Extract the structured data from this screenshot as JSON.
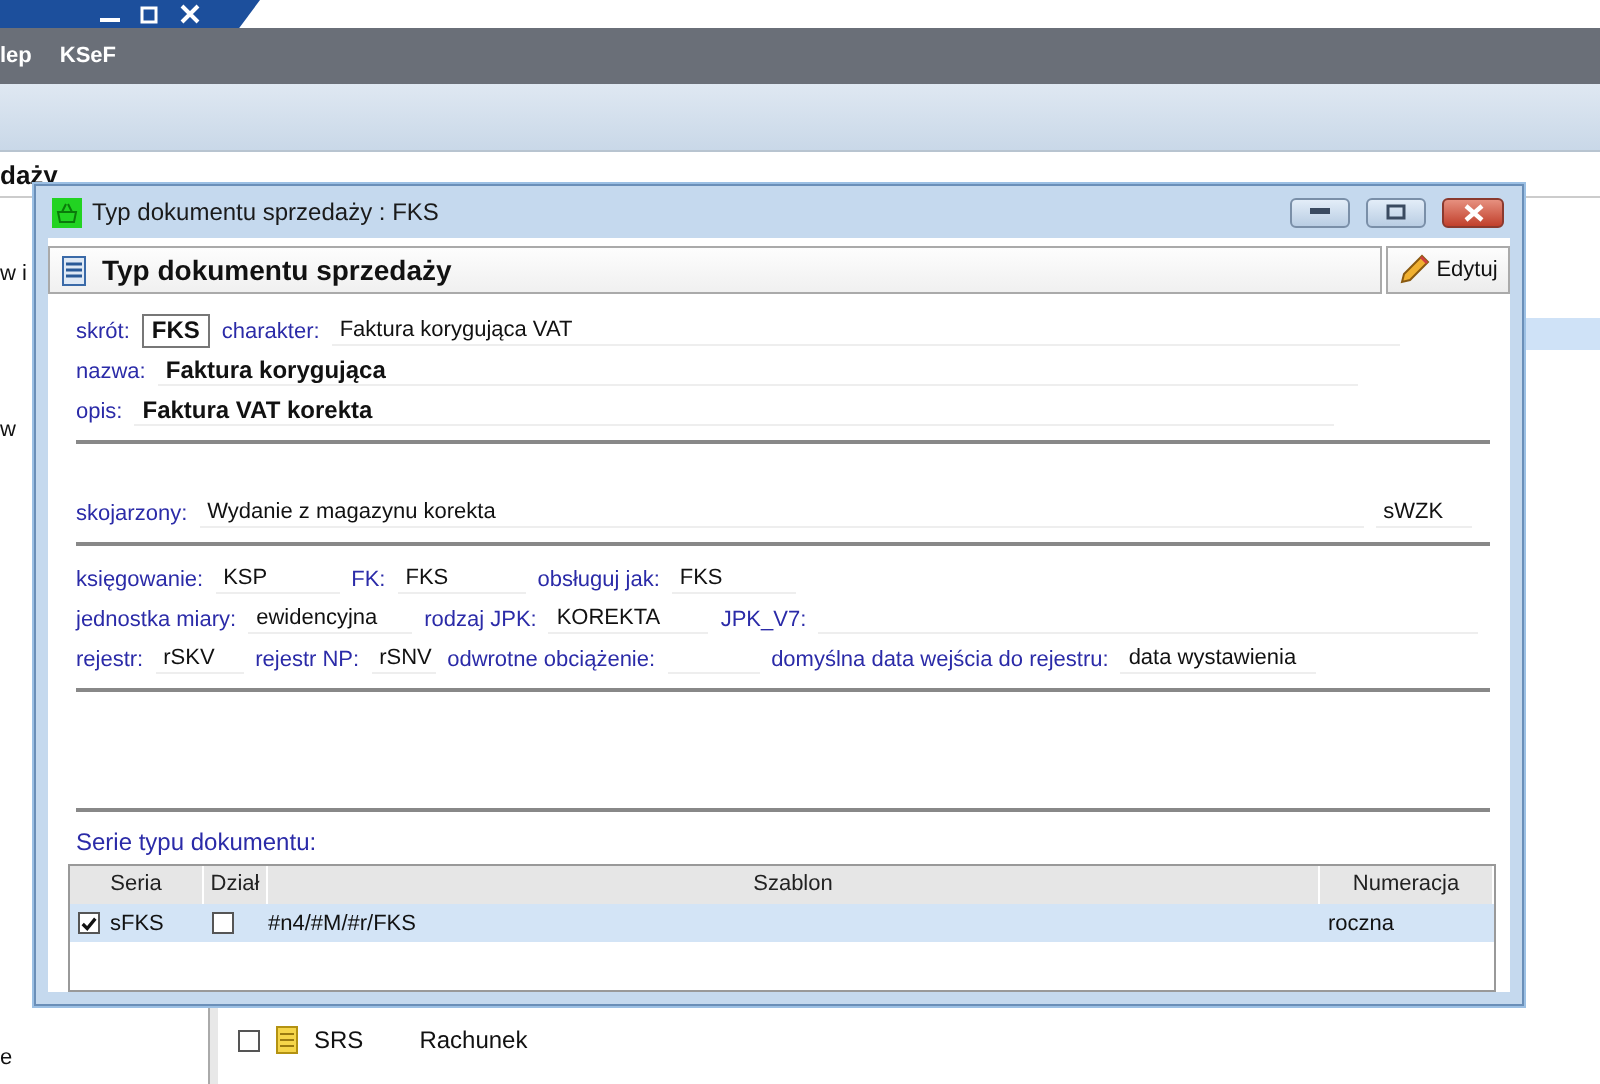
{
  "app": {
    "menu": [
      "lep",
      "KSeF"
    ],
    "heading": "daży",
    "left_pane": [
      "w i",
      "w",
      "e"
    ],
    "list_rows": [
      {
        "checked": false,
        "code": "SRS",
        "name": "Rachunek"
      }
    ]
  },
  "dialog": {
    "title": "Typ dokumentu sprzedaży : FKS",
    "header": "Typ dokumentu sprzedaży",
    "edit_button": "Edytuj",
    "sections": [
      [
        [
          {
            "label": "skrót:",
            "value": "FKS",
            "kind": "boxed"
          },
          {
            "label": "charakter:",
            "value": "Faktura korygująca VAT",
            "kind": "text"
          }
        ],
        [
          {
            "label": "nazwa:",
            "value": "Faktura korygująca",
            "kind": "bold"
          }
        ],
        [
          {
            "label": "opis:",
            "value": "Faktura VAT korekta",
            "kind": "bold"
          }
        ]
      ],
      [
        [
          {
            "label": "skojarzony:",
            "value": "Wydanie z magazynu korekta",
            "kind": "text"
          },
          {
            "value": "sWZK",
            "kind": "text"
          }
        ]
      ],
      [
        [
          {
            "label": "księgowanie:",
            "value": "KSP",
            "kind": "text"
          },
          {
            "label": "FK:",
            "value": "FKS",
            "kind": "text"
          },
          {
            "label": "obsługuj jak:",
            "value": "FKS",
            "kind": "text"
          }
        ],
        [
          {
            "label": "jednostka miary:",
            "value": "ewidencyjna",
            "kind": "text"
          },
          {
            "label": "rodzaj JPK:",
            "value": "KOREKTA",
            "kind": "text"
          },
          {
            "label": "JPK_V7:",
            "kind": "text"
          }
        ],
        [
          {
            "label": "rejestr:",
            "value": "rSKV",
            "kind": "text"
          },
          {
            "label": "rejestr NP:",
            "value": "rSNV",
            "kind": "text"
          },
          {
            "label": "odwrotne obciążenie:",
            "kind": "text"
          },
          {
            "label": "domyślna data wejścia do rejestru:",
            "value": "data wystawienia",
            "kind": "text"
          }
        ]
      ]
    ],
    "series_title": "Serie typu dokumentu:",
    "table": {
      "columns": [
        "Seria",
        "Dział",
        "Szablon",
        "Numeracja"
      ],
      "rows": [
        {
          "selected": true,
          "checked": true,
          "seria": "sFKS",
          "dzial_checked": false,
          "szablon": "#n4/#M/#r/FKS",
          "numeracja": "roczna"
        }
      ]
    }
  }
}
